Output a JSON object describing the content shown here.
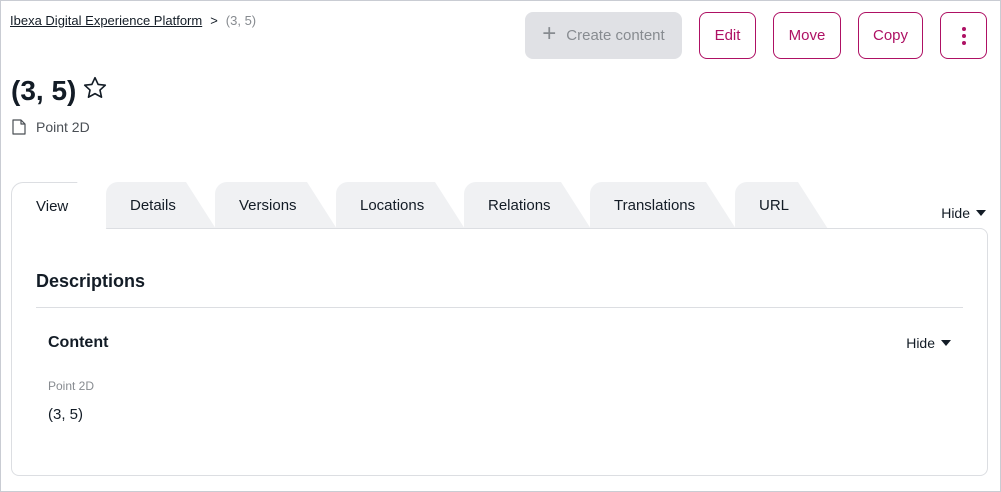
{
  "breadcrumb": {
    "root": "Ibexa Digital Experience Platform",
    "separator": ">",
    "current": "(3, 5)"
  },
  "actions": {
    "create_label": "Create content",
    "edit_label": "Edit",
    "move_label": "Move",
    "copy_label": "Copy",
    "more_icon": "kebab-menu-icon"
  },
  "header": {
    "title": "(3, 5)",
    "content_type": "Point 2D",
    "type_icon": "file-icon",
    "bookmark_icon": "star-icon"
  },
  "tabs": [
    {
      "label": "View",
      "active": true
    },
    {
      "label": "Details",
      "active": false
    },
    {
      "label": "Versions",
      "active": false
    },
    {
      "label": "Locations",
      "active": false
    },
    {
      "label": "Relations",
      "active": false
    },
    {
      "label": "Translations",
      "active": false
    },
    {
      "label": "URL",
      "active": false
    }
  ],
  "tabs_toggle": "Hide",
  "panel": {
    "section_title": "Descriptions",
    "group_title": "Content",
    "group_toggle": "Hide",
    "field_label": "Point 2D",
    "field_value": "(3, 5)"
  },
  "colors": {
    "accent": "#ae1164",
    "disabled_bg": "#e0e1e5",
    "tab_bg": "#f0f1f3",
    "border": "#dcdee2"
  }
}
